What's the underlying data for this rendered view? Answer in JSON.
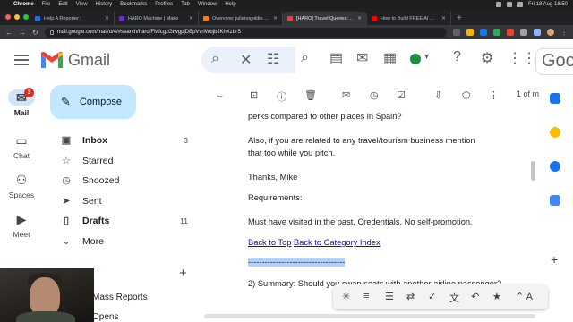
{
  "menubar": {
    "apple": "",
    "app": "Chrome",
    "items": [
      "File",
      "Edit",
      "View",
      "History",
      "Bookmarks",
      "Profiles",
      "Tab",
      "Window",
      "Help"
    ],
    "clock": "Fri 18 Aug 18:50"
  },
  "tabs": [
    {
      "title": "Help A Reporter |",
      "favicon_color": "#1a73e8",
      "active": false
    },
    {
      "title": "HARO Machine | Make",
      "favicon_color": "#6d28d9",
      "active": false
    },
    {
      "title": "Overview: julianogoldie.com/ - A",
      "favicon_color": "#ff7a00",
      "active": false
    },
    {
      "title": "[HARO] Travel Queries: Morni",
      "favicon_color": "#ea4335",
      "active": true
    },
    {
      "title": "How to Build FREE AI SEO Tool",
      "favicon_color": "#ff0000",
      "active": false
    }
  ],
  "toolbar": {
    "url": "mail.google.com/mail/u/4/#search/haro/FMfcgzGtwgpjDBpVvrlWbjbJKhXzbrS"
  },
  "gmail": {
    "logo_text": "Gmail",
    "brand_colors": {
      "red": "#ea4335",
      "blue": "#4285f4",
      "green": "#34a853",
      "yellow": "#fbbc04"
    },
    "google_badge": "Goog"
  },
  "rail": {
    "mail": {
      "label": "Mail",
      "badge": "3"
    },
    "chat": {
      "label": "Chat"
    },
    "spaces": {
      "label": "Spaces"
    },
    "meet": {
      "label": "Meet"
    }
  },
  "compose": {
    "label": "Compose"
  },
  "nav": [
    {
      "label": "Inbox",
      "icon": "inbox-icon",
      "count": "3",
      "bold": true
    },
    {
      "label": "Starred",
      "icon": "star-icon",
      "count": "",
      "bold": false
    },
    {
      "label": "Snoozed",
      "icon": "clock-icon",
      "count": "",
      "bold": false
    },
    {
      "label": "Sent",
      "icon": "send-icon",
      "count": "",
      "bold": false
    },
    {
      "label": "Drafts",
      "icon": "draft-icon",
      "count": "11",
      "bold": true
    },
    {
      "label": "More",
      "icon": "chevron-down-icon",
      "count": "",
      "bold": false
    }
  ],
  "labels": {
    "items": [
      "Mass Reports",
      "Opens"
    ]
  },
  "message_toolbar": {
    "pager": "1 of m"
  },
  "message": {
    "line1": "perks compared to other places in Spain?",
    "line2": "Also, if you are related to any travel/tourism business mention",
    "line3": "that too while you pitch.",
    "line4": "Thanks, Mike",
    "line5": "Requirements:",
    "line6": "Must have visited in the past, Credentials, No self-promotion.",
    "link_top": "Back to Top",
    "link_category": "Back to Category Index",
    "divider": "-----------------------------------",
    "line7": "2) Summary: Should you swap seats with another airline passenger?"
  },
  "floating_toolbar": {
    "font_label": "A"
  }
}
